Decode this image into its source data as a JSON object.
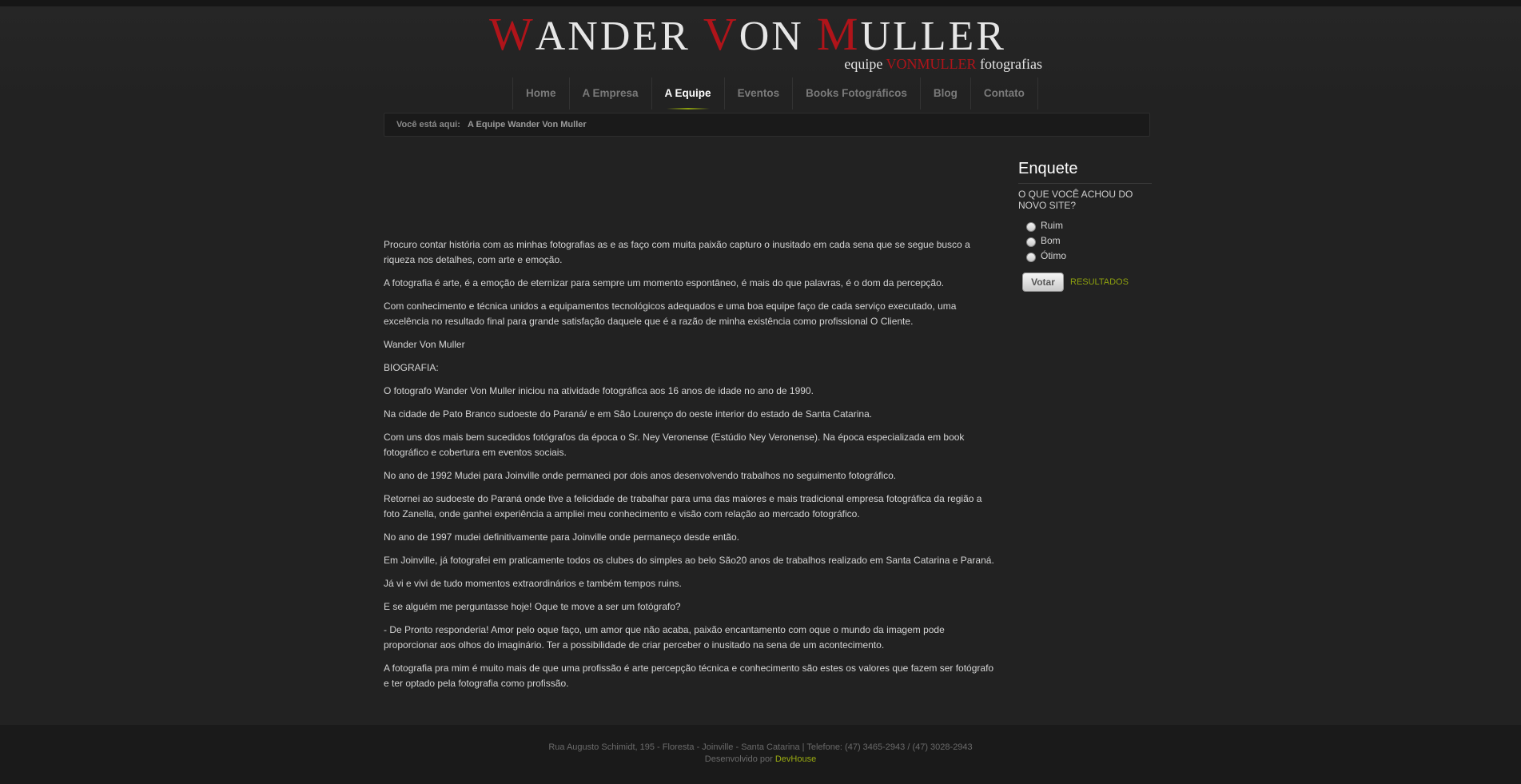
{
  "logo": {
    "title_parts": [
      {
        "cap": "W",
        "rest": "ANDER "
      },
      {
        "cap": "V",
        "rest": "ON "
      },
      {
        "cap": "M",
        "rest": "ULLER"
      }
    ],
    "subtitle_prefix": "equipe ",
    "subtitle_brand": "VONMULLER",
    "subtitle_suffix": " fotografias"
  },
  "nav": {
    "items": [
      {
        "label": "Home"
      },
      {
        "label": "A Empresa"
      },
      {
        "label": "A Equipe"
      },
      {
        "label": "Eventos"
      },
      {
        "label": "Books Fotográficos"
      },
      {
        "label": "Blog"
      },
      {
        "label": "Contato"
      }
    ],
    "active": "A Equipe"
  },
  "breadcrumb": {
    "prefix": "Você está aqui:",
    "current": "A Equipe Wander Von Muller"
  },
  "content": {
    "paragraphs": [
      "Procuro contar história com as minhas fotografias as e as faço com muita paixão capturo o inusitado em cada sena que se segue busco a riqueza nos detalhes, com arte e emoção.",
      "A fotografia é arte, é a emoção de eternizar para sempre um momento espontâneo, é mais do que palavras, é o dom da percepção.",
      "Com conhecimento e técnica unidos a equipamentos tecnológicos adequados e uma boa equipe faço de cada serviço executado, uma excelência no resultado final para grande satisfação daquele que é a razão de minha existência como profissional O Cliente.",
      "Wander Von Muller",
      "BIOGRAFIA:",
      "O fotografo Wander Von Muller iniciou na atividade fotográfica aos 16 anos de idade no ano de 1990.",
      "Na cidade de Pato Branco sudoeste do Paraná/ e em São Lourenço do oeste interior do estado de Santa Catarina.",
      "Com uns dos mais bem sucedidos fotógrafos da época o Sr. Ney Veronense (Estúdio Ney Veronense). Na época especializada em book fotográfico e cobertura em eventos sociais.",
      "No ano de 1992 Mudei para Joinville onde permaneci por dois anos desenvolvendo trabalhos no seguimento fotográfico.",
      "Retornei ao sudoeste do Paraná onde tive a felicidade de trabalhar para uma das maiores e mais tradicional empresa fotográfica da região a foto Zanella, onde ganhei experiência a ampliei meu conhecimento e visão com relação ao mercado fotográfico.",
      "No ano de 1997 mudei definitivamente para Joinville onde permaneço desde então.",
      "Em Joinville, já fotografei em praticamente todos os clubes do simples ao belo São20 anos de trabalhos realizado em Santa Catarina e Paraná.",
      "Já vi e vivi de tudo momentos extraordinários e também tempos ruins.",
      "E se alguém me perguntasse hoje! Oque te move a ser um fotógrafo?",
      "- De Pronto responderia! Amor pelo oque faço, um amor que não acaba, paixão encantamento com oque o mundo da imagem pode proporcionar aos olhos do imaginário. Ter a possibilidade de criar perceber o inusitado na sena de um acontecimento.",
      "A fotografia pra mim é muito mais de que uma profissão é arte percepção técnica e conhecimento são estes os valores que fazem ser fotógrafo e ter optado pela fotografia como profissão."
    ]
  },
  "poll": {
    "title": "Enquete",
    "question": "O QUE VOCÊ ACHOU DO NOVO SITE?",
    "options": [
      "Ruim",
      "Bom",
      "Ótimo"
    ],
    "vote_label": "Votar",
    "results_label": "RESULTADOS"
  },
  "footer": {
    "address": "Rua Augusto Schimidt, 195 - Floresta - Joinville - Santa Catarina | Telefone: (47) 3465-2943 / (47) 3028-2943",
    "dev_prefix": "Desenvolvido por ",
    "dev_name": "DevHouse"
  },
  "colors": {
    "accent_red": "#b0141a",
    "accent_green": "#8da00f",
    "background": "#222222"
  }
}
